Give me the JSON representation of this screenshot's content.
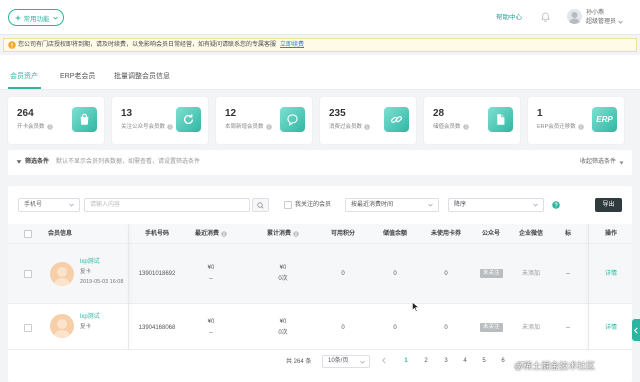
{
  "header": {
    "quick_button_label": "常用功能",
    "help_label": "帮助中心",
    "user_name": "孙小燕",
    "user_role": "超级管理员"
  },
  "notice": {
    "text": "您公司有门店授权即将到期，请及时续费，以免影响会员日常经营，如有疑问请联系您的专属客服",
    "link_label": "立即续费"
  },
  "tabs": [
    {
      "label": "会员资产",
      "active": true
    },
    {
      "label": "ERP老会员",
      "active": false
    },
    {
      "label": "批量调整会员信息",
      "active": false
    }
  ],
  "stats": [
    {
      "value": "264",
      "label": "开卡会员数",
      "icon": "bag-icon"
    },
    {
      "value": "13",
      "label": "关注公众号会员数",
      "icon": "refresh-icon"
    },
    {
      "value": "12",
      "label": "本周新增会员数",
      "icon": "chat-icon"
    },
    {
      "value": "235",
      "label": "消费过会员数",
      "icon": "link-icon"
    },
    {
      "value": "28",
      "label": "储值会员数",
      "icon": "document-icon"
    },
    {
      "value": "1",
      "label": "ERP会员迁移数",
      "icon": "erp-icon",
      "icon_text": "ERP"
    }
  ],
  "filter": {
    "title": "筛选条件",
    "hint": "默认不显示会员列表数据，如需查看，请设置筛选条件",
    "toggle_label": "收起筛选条件"
  },
  "toolbar": {
    "search_field": "手机号",
    "search_placeholder": "请输入内容",
    "follow_only_label": "我关注的会员",
    "sort_field": "按最近消费时间",
    "sort_order": "降序",
    "export_label": "导出"
  },
  "table": {
    "columns": [
      "会员信息",
      "手机号码",
      "最近消费",
      "累计消费",
      "可用积分",
      "储值余额",
      "未使用卡券",
      "公众号",
      "企业微信",
      "标",
      "操作"
    ],
    "rows": [
      {
        "name": "lxp测试",
        "card": "复卡",
        "date": "2019-05-03 16:08",
        "phone": "13901018692",
        "last_amount": "¥0",
        "last_time": "--",
        "total_amount": "¥0",
        "total_count": "0次",
        "points": "0",
        "balance": "0",
        "coupons": "0",
        "wechat": "未关注",
        "ent_wechat": "未添加",
        "tag": "--",
        "action": "详情"
      },
      {
        "name": "lxp测试",
        "card": "复卡",
        "phone": "13904168068",
        "last_amount": "¥0",
        "last_time": "--",
        "total_amount": "¥0",
        "total_count": "0次",
        "points": "0",
        "balance": "0",
        "coupons": "0",
        "wechat": "未关注",
        "ent_wechat": "未添加",
        "tag": "--",
        "action": "详情"
      }
    ]
  },
  "pagination": {
    "total_text": "共 264 条",
    "page_size": "10条/页",
    "pages": [
      "1",
      "2",
      "3",
      "4",
      "5",
      "6",
      "…"
    ]
  },
  "watermark": "@稀土掘金技术社区",
  "colors": {
    "accent": "#2bb5a0",
    "export_button": "#2f3b3d",
    "notice_background": "#fffbe8",
    "link": "#2d7fe0"
  }
}
